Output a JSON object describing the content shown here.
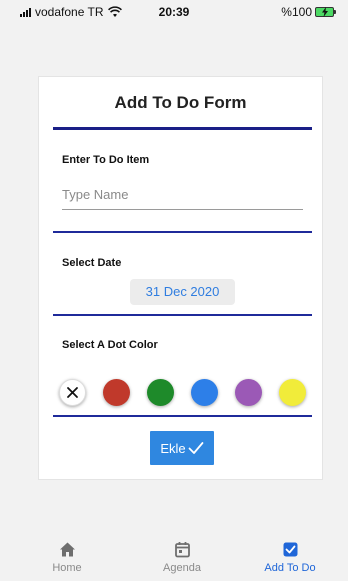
{
  "status_bar": {
    "carrier": "vodafone TR",
    "time": "20:39",
    "battery": "%100"
  },
  "form": {
    "title": "Add To Do Form",
    "item_label": "Enter To Do Item",
    "item_placeholder": "Type Name",
    "date_label": "Select Date",
    "date_value": "31 Dec 2020",
    "color_label": "Select A Dot Color",
    "dot_colors": [
      "#ffffff",
      "#c0392b",
      "#1e8a2a",
      "#2d7fe8",
      "#9b59b6",
      "#f1ec3a"
    ],
    "submit_label": "Ekle"
  },
  "tabs": [
    {
      "label": "Home",
      "icon": "home-icon"
    },
    {
      "label": "Agenda",
      "icon": "calendar-icon"
    },
    {
      "label": "Add To Do",
      "icon": "check-square-icon"
    }
  ],
  "colors": {
    "accent": "#1f66d8",
    "divider": "#1f2a9a",
    "button": "#2f87e0"
  }
}
